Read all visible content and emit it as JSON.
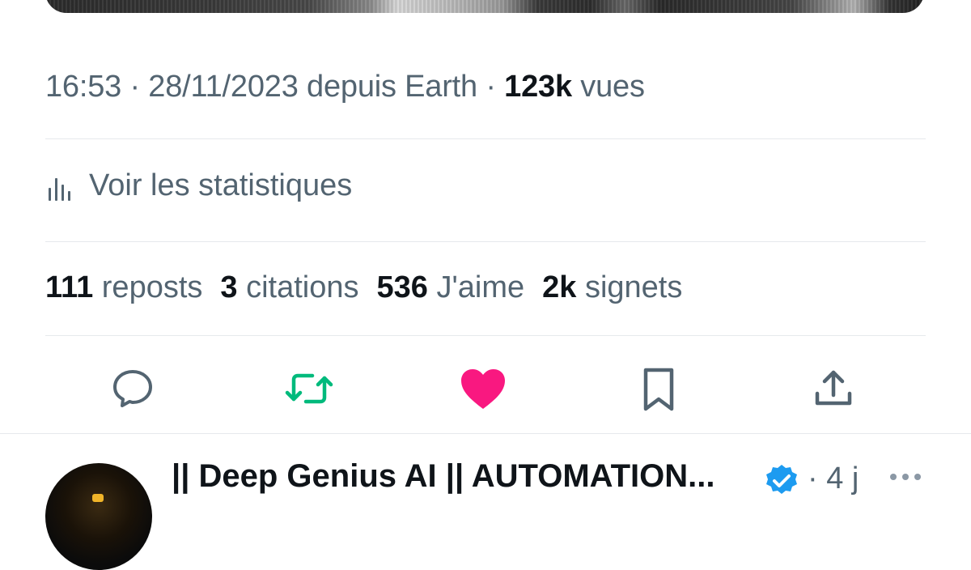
{
  "tweet_meta": {
    "time": "16:53",
    "date": "28/11/2023",
    "source": "depuis Earth",
    "views_count": "123k",
    "views_label": "vues",
    "sep": "·"
  },
  "stats_link": {
    "label": "Voir les statistiques",
    "icon": "analytics-bars-icon"
  },
  "engagement": {
    "reposts": {
      "count": "111",
      "label": "reposts"
    },
    "quotes": {
      "count": "3",
      "label": "citations"
    },
    "likes": {
      "count": "536",
      "label": "J'aime"
    },
    "bookmarks": {
      "count": "2k",
      "label": "signets"
    }
  },
  "actions": [
    {
      "name": "reply",
      "icon": "reply-bubble-icon",
      "color": "#536471"
    },
    {
      "name": "repost",
      "icon": "repost-arrows-icon",
      "color": "#00ba7c"
    },
    {
      "name": "like",
      "icon": "heart-filled-icon",
      "color": "#f91880"
    },
    {
      "name": "bookmark",
      "icon": "bookmark-icon",
      "color": "#536471"
    },
    {
      "name": "share",
      "icon": "share-upload-icon",
      "color": "#536471"
    }
  ],
  "reply": {
    "author_name": "|| Deep Genius AI || AUTOMATION...",
    "verified": true,
    "time_sep": "·",
    "time_ago": "4 j",
    "more_icon": "more-dots-icon"
  },
  "colors": {
    "text_primary": "#0f1419",
    "text_secondary": "#536471",
    "divider": "#e6e9ec",
    "verified_blue": "#1d9bf0"
  }
}
